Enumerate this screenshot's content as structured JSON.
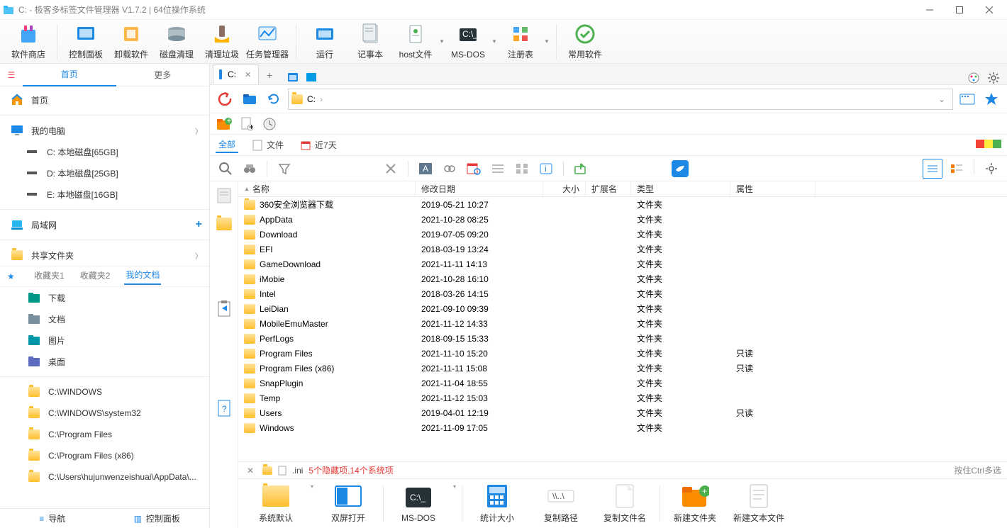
{
  "title": "C: - 极客多标签文件管理器 V1.7.2  |  64位操作系统",
  "ribbon": [
    {
      "id": "store",
      "label": "软件商店"
    },
    {
      "id": "cpl",
      "label": "控制面板"
    },
    {
      "id": "uninstall",
      "label": "卸载软件"
    },
    {
      "id": "diskclean",
      "label": "磁盘清理"
    },
    {
      "id": "trash",
      "label": "清理垃圾"
    },
    {
      "id": "taskmgr",
      "label": "任务管理器"
    },
    {
      "id": "run",
      "label": "运行"
    },
    {
      "id": "notepad",
      "label": "记事本"
    },
    {
      "id": "hosts",
      "label": "host文件"
    },
    {
      "id": "msdos",
      "label": "MS-DOS"
    },
    {
      "id": "regedit",
      "label": "注册表"
    },
    {
      "id": "common",
      "label": "常用软件"
    }
  ],
  "sidebar": {
    "tabs": {
      "home": "首页",
      "more": "更多"
    },
    "home_label": "首页",
    "my_pc": "我的电脑",
    "drives": [
      {
        "label": "C: 本地磁盘[65GB]"
      },
      {
        "label": "D: 本地磁盘[25GB]"
      },
      {
        "label": "E: 本地磁盘[16GB]"
      }
    ],
    "lan": "局域网",
    "share": "共享文件夹",
    "fav_tabs": {
      "f1": "收藏夹1",
      "f2": "收藏夹2",
      "docs": "我的文档"
    },
    "user_dirs": [
      {
        "label": "下载",
        "color": "#009688"
      },
      {
        "label": "文档",
        "color": "#78909c"
      },
      {
        "label": "图片",
        "color": "#0097a7"
      },
      {
        "label": "桌面",
        "color": "#5c6bc0"
      }
    ],
    "paths": [
      "C:\\WINDOWS",
      "C:\\WINDOWS\\system32",
      "C:\\Program Files",
      "C:\\Program Files (x86)",
      "C:\\Users\\hujunwenzeishuai\\AppData\\..."
    ],
    "footer": {
      "nav": "导航",
      "cpl": "控制面板"
    }
  },
  "tab": {
    "label": "C:"
  },
  "address": {
    "path": "C:"
  },
  "filters": {
    "all": "全部",
    "file": "文件",
    "recent": "近7天"
  },
  "columns": {
    "name": "名称",
    "date": "修改日期",
    "size": "大小",
    "ext": "扩展名",
    "type": "类型",
    "attr": "属性"
  },
  "rows": [
    {
      "name": "360安全浏览器下载",
      "date": "2019-05-21 10:27",
      "type": "文件夹",
      "attr": ""
    },
    {
      "name": "AppData",
      "date": "2021-10-28 08:25",
      "type": "文件夹",
      "attr": ""
    },
    {
      "name": "Download",
      "date": "2019-07-05 09:20",
      "type": "文件夹",
      "attr": ""
    },
    {
      "name": "EFI",
      "date": "2018-03-19 13:24",
      "type": "文件夹",
      "attr": ""
    },
    {
      "name": "GameDownload",
      "date": "2021-11-11 14:13",
      "type": "文件夹",
      "attr": ""
    },
    {
      "name": "iMobie",
      "date": "2021-10-28 16:10",
      "type": "文件夹",
      "attr": ""
    },
    {
      "name": "Intel",
      "date": "2018-03-26 14:15",
      "type": "文件夹",
      "attr": ""
    },
    {
      "name": "LeiDian",
      "date": "2021-09-10 09:39",
      "type": "文件夹",
      "attr": ""
    },
    {
      "name": "MobileEmuMaster",
      "date": "2021-11-12 14:33",
      "type": "文件夹",
      "attr": ""
    },
    {
      "name": "PerfLogs",
      "date": "2018-09-15 15:33",
      "type": "文件夹",
      "attr": ""
    },
    {
      "name": "Program Files",
      "date": "2021-11-10 15:20",
      "type": "文件夹",
      "attr": "只读"
    },
    {
      "name": "Program Files (x86)",
      "date": "2021-11-11 15:08",
      "type": "文件夹",
      "attr": "只读"
    },
    {
      "name": "SnapPlugin",
      "date": "2021-11-04 18:55",
      "type": "文件夹",
      "attr": ""
    },
    {
      "name": "Temp",
      "date": "2021-11-12 15:03",
      "type": "文件夹",
      "attr": ""
    },
    {
      "name": "Users",
      "date": "2019-04-01 12:19",
      "type": "文件夹",
      "attr": "只读"
    },
    {
      "name": "Windows",
      "date": "2021-11-09 17:05",
      "type": "文件夹",
      "attr": ""
    }
  ],
  "status": {
    "ext": ".ini",
    "warn": "5个隐藏项,14个系统项",
    "hint": "按住Ctrl多选"
  },
  "bottom": [
    {
      "id": "default",
      "label": "系统默认"
    },
    {
      "id": "split",
      "label": "双屏打开"
    },
    {
      "id": "dos",
      "label": "MS-DOS"
    },
    {
      "id": "stat",
      "label": "统计大小"
    },
    {
      "id": "cpath",
      "label": "复制路径"
    },
    {
      "id": "cname",
      "label": "复制文件名"
    },
    {
      "id": "newfolder",
      "label": "新建文件夹"
    },
    {
      "id": "newtxt",
      "label": "新建文本文件"
    }
  ]
}
